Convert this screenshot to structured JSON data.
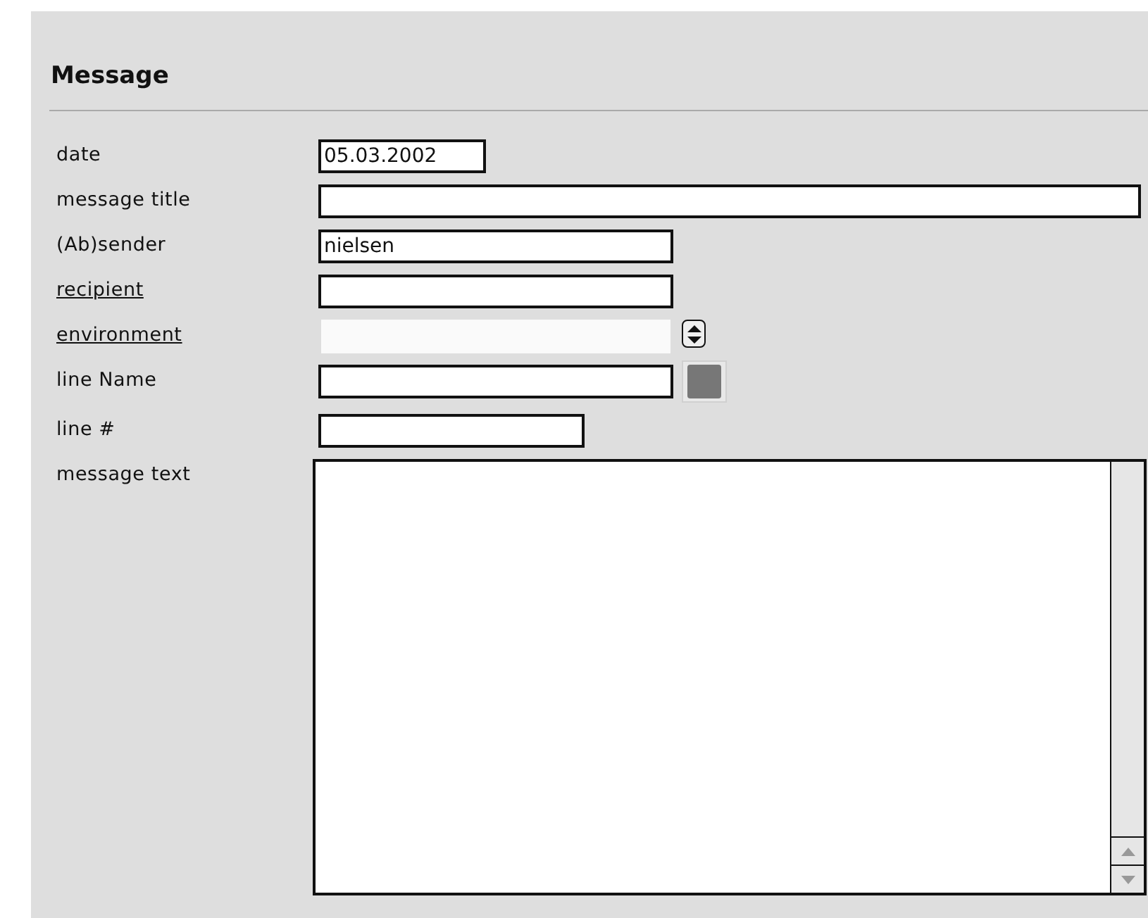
{
  "section": {
    "title": "Message"
  },
  "fields": [
    {
      "kind": "text",
      "label": "date",
      "underlined": false,
      "value": "05.03.2002"
    },
    {
      "kind": "text",
      "label": "message title",
      "underlined": false
    },
    {
      "kind": "text",
      "label": "(Ab)sender",
      "underlined": false,
      "value": "nielsen"
    },
    {
      "kind": "text",
      "label": "recipient",
      "underlined": true
    },
    {
      "kind": "popup",
      "label": "environment",
      "underlined": true
    },
    {
      "kind": "swatch",
      "label": "line Name",
      "underlined": false
    },
    {
      "kind": "text",
      "label": "line #",
      "underlined": false
    },
    {
      "kind": "textarea",
      "label": "message text",
      "underlined": false
    }
  ]
}
